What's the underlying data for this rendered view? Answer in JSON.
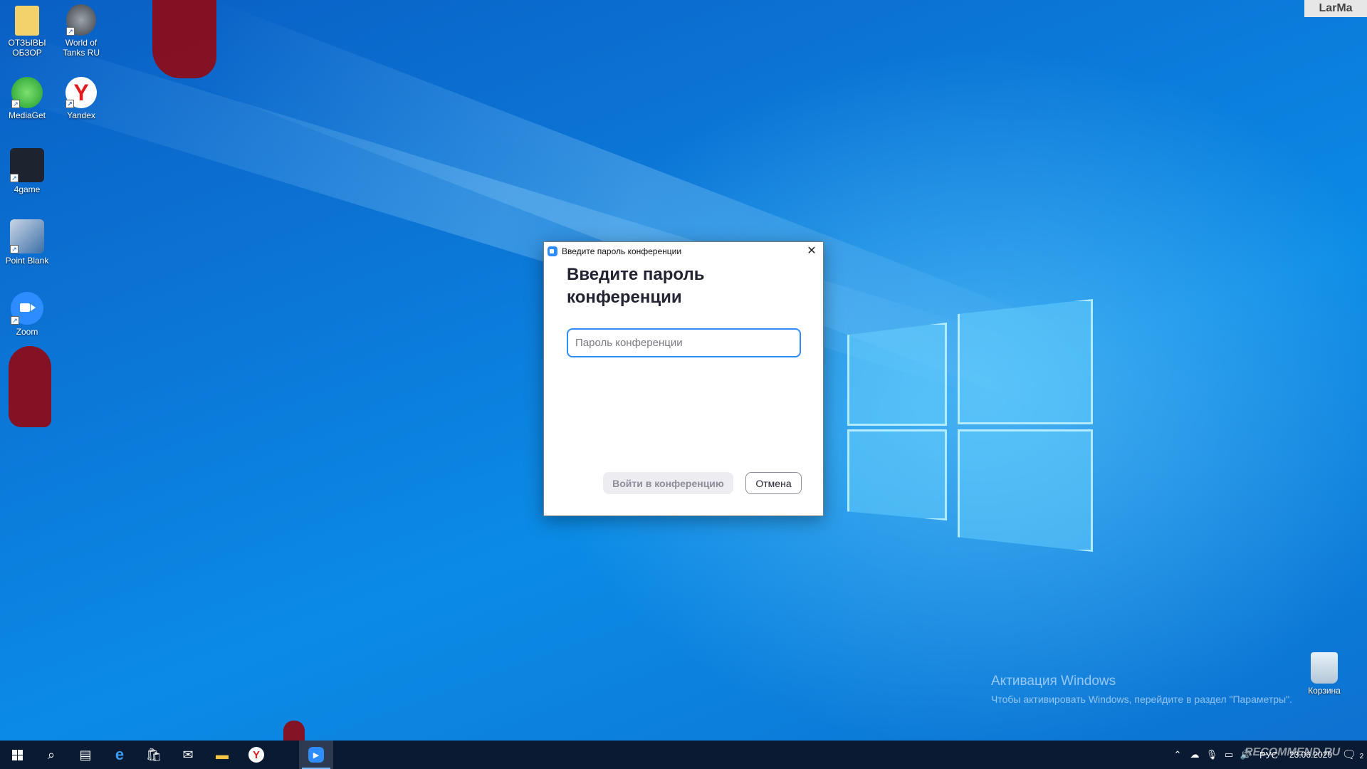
{
  "desktop": {
    "icons": [
      {
        "label": "ОТЗЫВЫ ОБЗОР",
        "icon": "folder-icon"
      },
      {
        "label": "World of Tanks RU",
        "icon": "world-of-tanks-icon"
      },
      {
        "label": "MediaGet",
        "icon": "mediaget-icon"
      },
      {
        "label": "Yandex",
        "icon": "yandex-browser-icon"
      },
      {
        "label": "4game",
        "icon": "4game-icon"
      },
      {
        "label": "Point Blank",
        "icon": "point-blank-icon"
      },
      {
        "label": "Zoom",
        "icon": "zoom-icon"
      },
      {
        "label": "Корзина",
        "icon": "recycle-bin-icon"
      }
    ],
    "watermark": "LarMa",
    "activation": {
      "title": "Активация Windows",
      "subtitle": "Чтобы активировать Windows, перейдите в раздел \"Параметры\"."
    }
  },
  "dialog": {
    "window_title": "Введите пароль конференции",
    "heading": "Введите пароль конференции",
    "password_placeholder": "Пароль конференции",
    "password_value": "",
    "join_label": "Войти в конференцию",
    "cancel_label": "Отмена",
    "accent_color": "#2d8cff"
  },
  "taskbar": {
    "apps": [
      "start-icon",
      "search-icon",
      "task-view-icon",
      "edge-icon",
      "store-icon",
      "mail-icon",
      "file-explorer-icon",
      "yandex-browser-icon",
      "zoom-icon"
    ],
    "active_app": "zoom-icon",
    "language": "РУС",
    "date": "23.06.2020",
    "notifications": "2",
    "watermark": "RECOMMEND.RU"
  }
}
